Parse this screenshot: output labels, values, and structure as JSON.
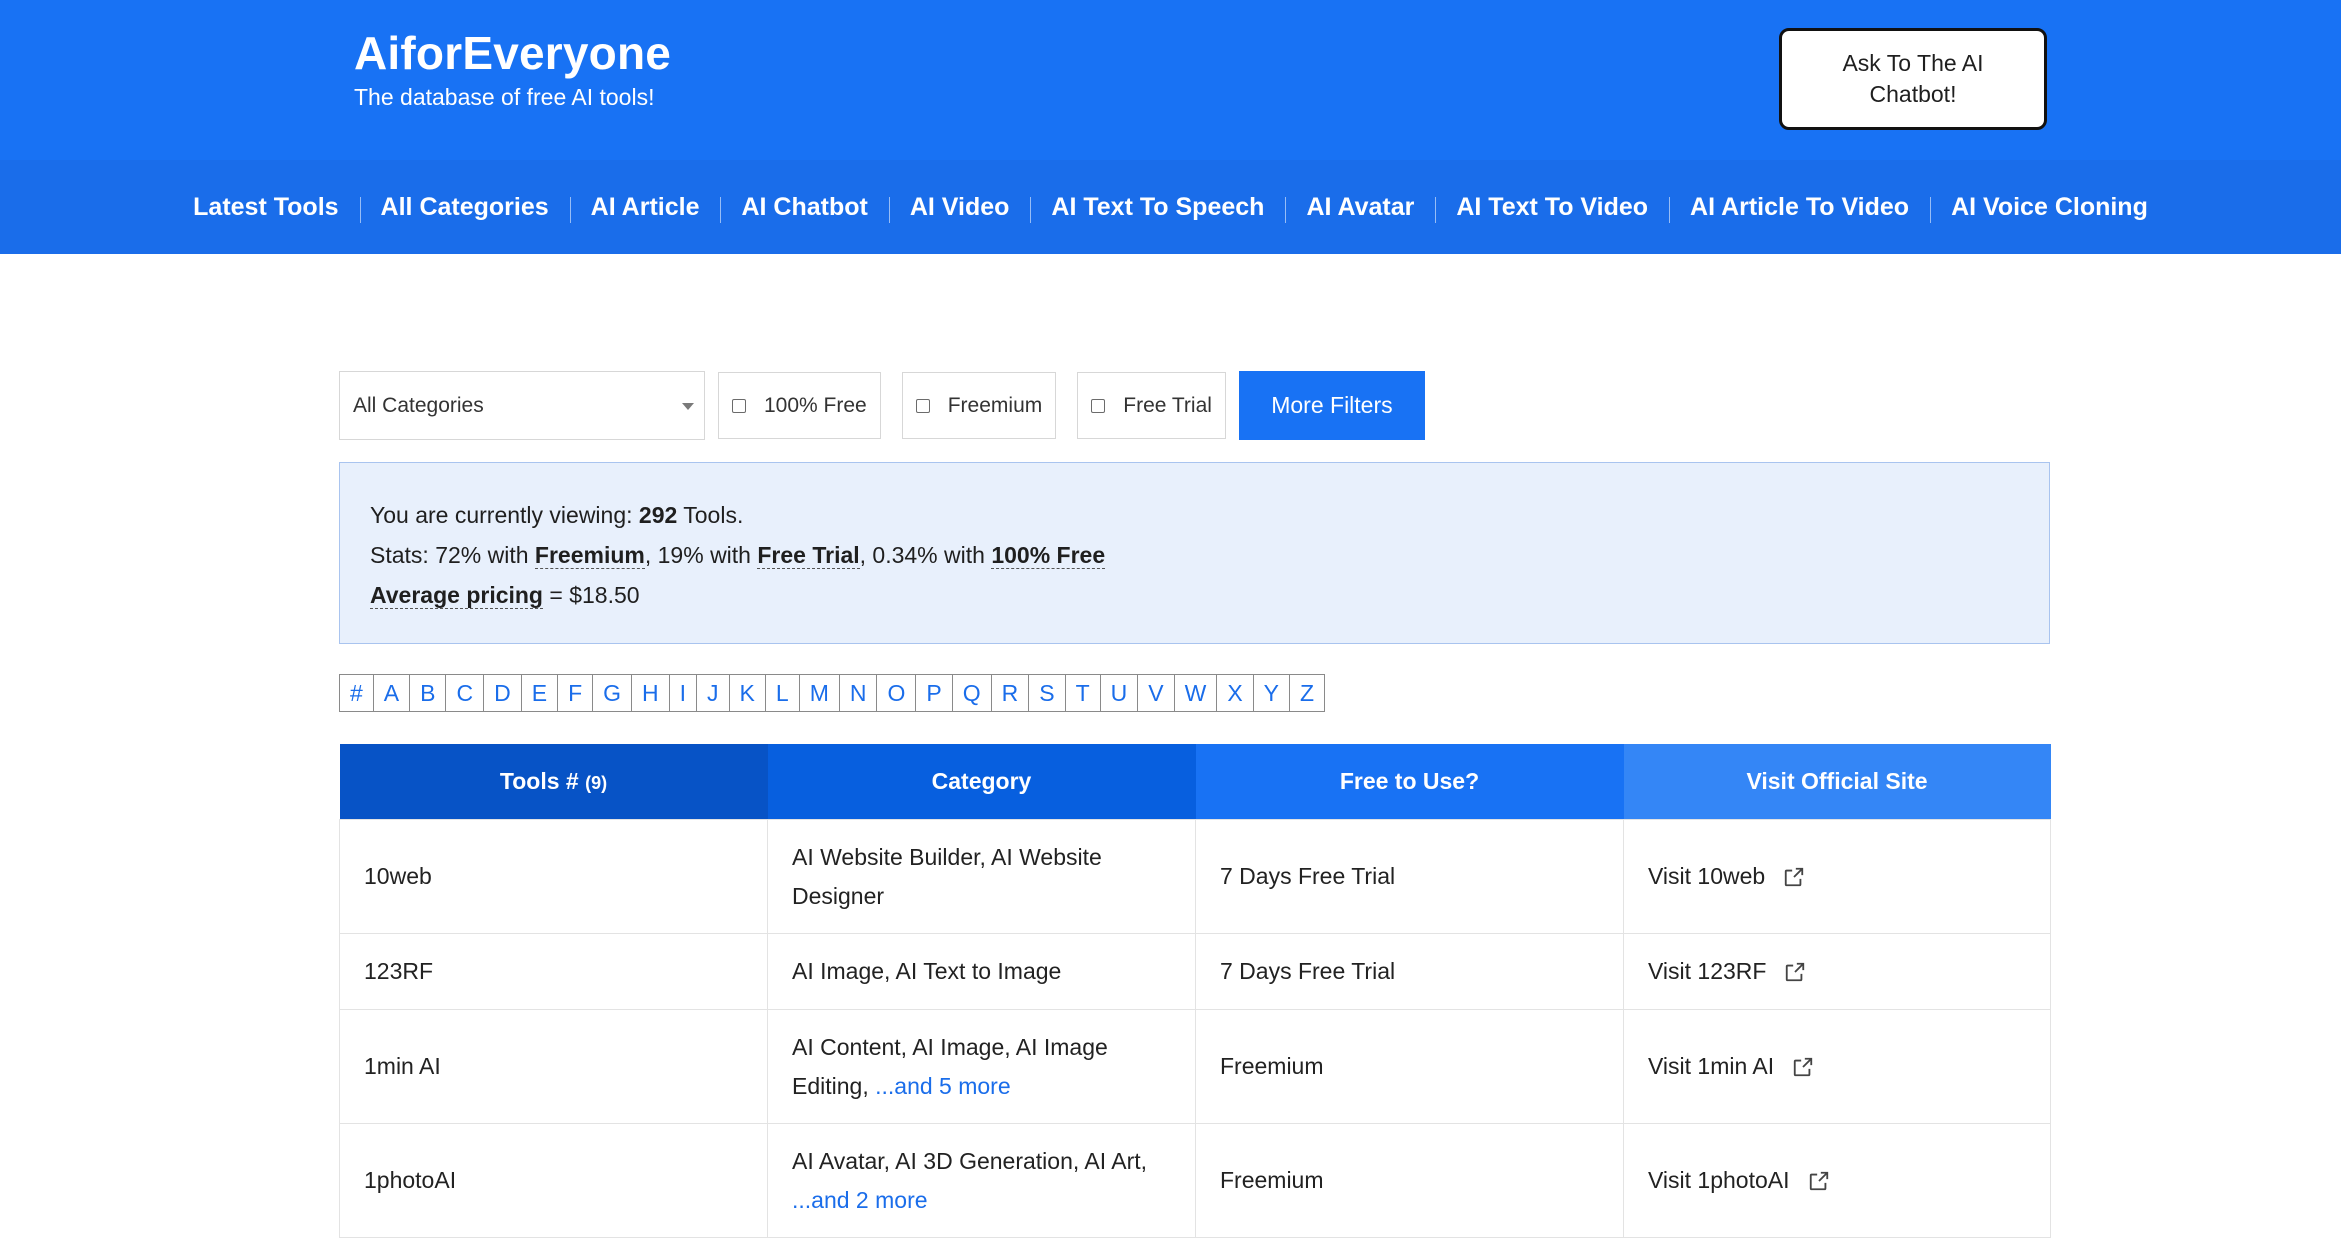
{
  "header": {
    "title": "AiforEveryone",
    "subtitle": "The database of free AI tools!",
    "chat_button": "Ask To The AI Chatbot!"
  },
  "nav": {
    "items": [
      {
        "label": "Latest Tools"
      },
      {
        "label": "All Categories"
      },
      {
        "label": "AI Article"
      },
      {
        "label": "AI Chatbot"
      },
      {
        "label": "AI Video"
      },
      {
        "label": "AI Text To Speech"
      },
      {
        "label": "AI Avatar"
      },
      {
        "label": "AI Text To Video"
      },
      {
        "label": "AI Article To Video"
      },
      {
        "label": "AI Voice Cloning"
      }
    ]
  },
  "filters": {
    "category_select": "All Categories",
    "checkboxes": [
      {
        "label": "100% Free",
        "checked": false
      },
      {
        "label": "Freemium",
        "checked": false
      },
      {
        "label": "Free Trial",
        "checked": false
      }
    ],
    "more_button": "More Filters"
  },
  "stats": {
    "viewing_prefix": "You are currently viewing: ",
    "viewing_count": "292",
    "viewing_suffix": " Tools.",
    "stats_prefix": "Stats: 72% with ",
    "freemium": "Freemium",
    "mid1": ", 19% with ",
    "free_trial": "Free Trial",
    "mid2": ", 0.34% with ",
    "free_100": "100% Free",
    "avg_label": "Average pricing",
    "avg_value": " = $18.50"
  },
  "alphabet": [
    "#",
    "A",
    "B",
    "C",
    "D",
    "E",
    "F",
    "G",
    "H",
    "I",
    "J",
    "K",
    "L",
    "M",
    "N",
    "O",
    "P",
    "Q",
    "R",
    "S",
    "T",
    "U",
    "V",
    "W",
    "X",
    "Y",
    "Z"
  ],
  "table": {
    "headers": {
      "tools": "Tools # ",
      "tools_count": "(9)",
      "category": "Category",
      "free": "Free to Use?",
      "visit": "Visit Official Site"
    },
    "rows": [
      {
        "name": "10web",
        "category": "AI Website Builder, AI Website Designer",
        "more": "",
        "free": "7 Days Free Trial",
        "visit": "Visit 10web"
      },
      {
        "name": "123RF",
        "category": "AI Image, AI Text to Image",
        "more": "",
        "free": "7 Days Free Trial",
        "visit": "Visit 123RF"
      },
      {
        "name": "1min AI",
        "category": "AI Content, AI Image, AI Image Editing, ",
        "more": "...and 5 more",
        "free": "Freemium",
        "visit": "Visit 1min AI"
      },
      {
        "name": "1photoAI",
        "category": "AI Avatar, AI 3D Generation, AI Art, ",
        "more": "...and 2 more",
        "free": "Freemium",
        "visit": "Visit 1photoAI"
      }
    ]
  },
  "colors": {
    "header_bg": "#1872f4",
    "nav_bg": "#1a6dea",
    "accent": "#1872f4",
    "stats_bg": "#e8f0fc"
  },
  "icons": {
    "external": "external-link-icon",
    "caret": "chevron-down-icon"
  }
}
